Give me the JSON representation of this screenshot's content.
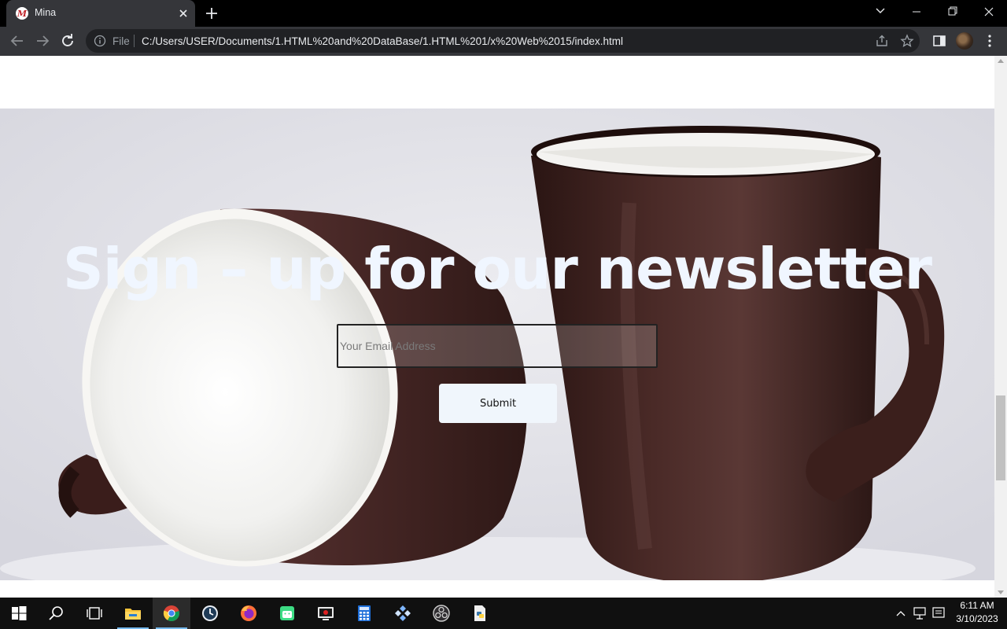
{
  "browser": {
    "tab_title": "Mina",
    "omnibox_scheme_label": "File",
    "url": "C:/Users/USER/Documents/1.HTML%20and%20DataBase/1.HTML%201/x%20Web%2015/index.html"
  },
  "page": {
    "headline": "Sign – up for our newsletter",
    "email_placeholder": "Your Email Address",
    "submit_label": "Submit"
  },
  "taskbar": {
    "apps": [
      "start-icon",
      "search-icon",
      "task-view-icon",
      "file-explorer-icon",
      "chrome-icon",
      "clock-app-icon",
      "firefox-icon",
      "android-studio-icon",
      "screen-recorder-icon",
      "calculator-icon",
      "game-app-icon",
      "obs-icon",
      "python-file-icon"
    ],
    "time": "6:11 AM",
    "date": "3/10/2023"
  },
  "colors": {
    "headline": "#f0f6ff",
    "button_bg": "#f0f6fc",
    "mug": "#3a1f1c"
  }
}
